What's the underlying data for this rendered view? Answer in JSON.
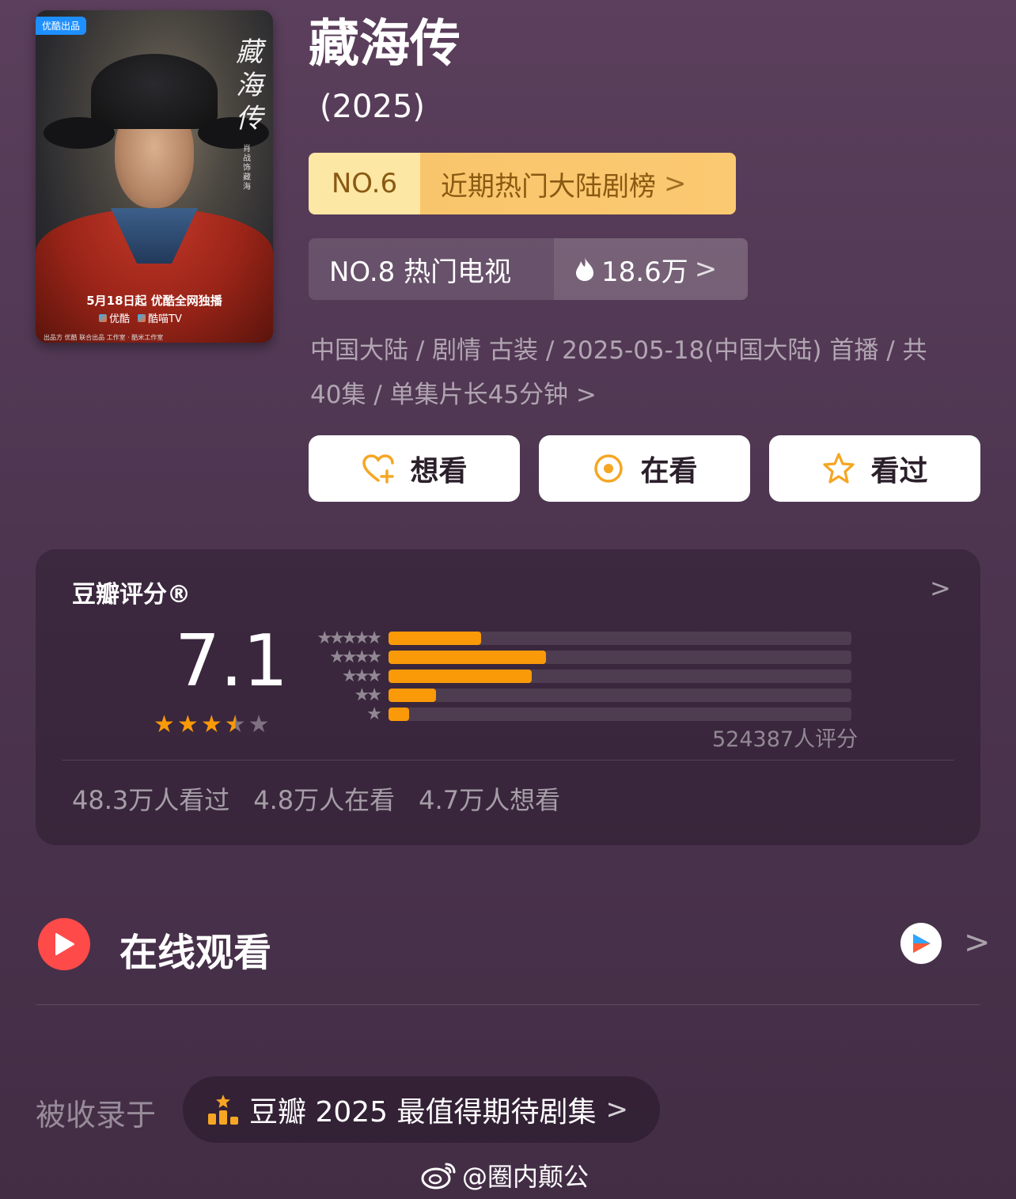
{
  "poster": {
    "badge": "优酷出品",
    "title_vertical": "藏海传",
    "actor": "肖战 饰 藏海",
    "release": "5月18日起 优酷全网独播",
    "platforms": [
      "优酷",
      "酷喵TV"
    ],
    "credits": "出品方 优酷   联合出品   工作室 · 酷米工作室"
  },
  "title": "藏海传",
  "year": "(2025)",
  "rank_primary": {
    "no": "NO.6",
    "label": "近期热门大陆剧榜",
    "chevron": ">"
  },
  "rank_secondary": {
    "no": "NO.8 热门电视",
    "heat": "18.6万",
    "chevron": ">"
  },
  "info_line1": "中国大陆 / 剧情 古装 / 2025-05-18(中国大陆) 首播 / 共",
  "info_line2": "40集 / 单集片长45分钟 >",
  "actions": {
    "want": "想看",
    "watching": "在看",
    "watched": "看过"
  },
  "rating": {
    "title": "豆瓣评分®",
    "score": "7.1",
    "stars_filled": 3.5,
    "star_labels": [
      "★★★★★",
      "★★★★",
      "★★★",
      "★★",
      "★"
    ],
    "distribution": [
      0.2,
      0.34,
      0.31,
      0.103,
      0.045
    ],
    "count": "524387人评分",
    "stat_watched": "48.3万人看过",
    "stat_watching": "4.8万人在看",
    "stat_want": "4.7万人想看"
  },
  "online": {
    "title": "在线观看"
  },
  "collected": {
    "label": "被收录于",
    "list": "豆瓣 2025 最值得期待剧集"
  },
  "watermark": "@圈内颠公",
  "colors": {
    "accent_orange": "#fa9a09",
    "rank_gold": "#fbc971",
    "play_red": "#ff4a4a"
  }
}
